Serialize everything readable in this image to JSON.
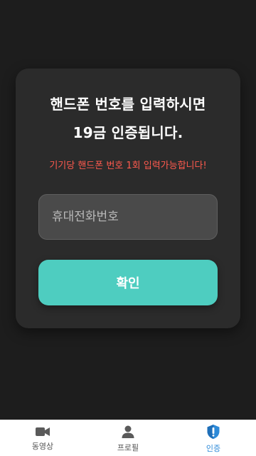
{
  "card": {
    "title_line1": "핸드폰 번호를 입력하시면",
    "title_line2": "19금 인증됩니다.",
    "notice": "기기당 핸드폰 번호 1회 입력가능합니다!"
  },
  "phone_input": {
    "placeholder": "휴대전화번호",
    "value": ""
  },
  "confirm_button": {
    "label": "확인",
    "color": "#4ecdc0"
  },
  "bottom_nav": {
    "items": [
      {
        "label": "동영상",
        "icon": "video-camera-icon",
        "active": false
      },
      {
        "label": "프로필",
        "icon": "person-icon",
        "active": false
      },
      {
        "label": "인증",
        "icon": "shield-icon",
        "active": true
      }
    ],
    "active_color": "#2d8ad8"
  },
  "colors": {
    "background": "#1d1d1d",
    "card": "#2b2b2b",
    "notice": "#ff5a4e"
  }
}
